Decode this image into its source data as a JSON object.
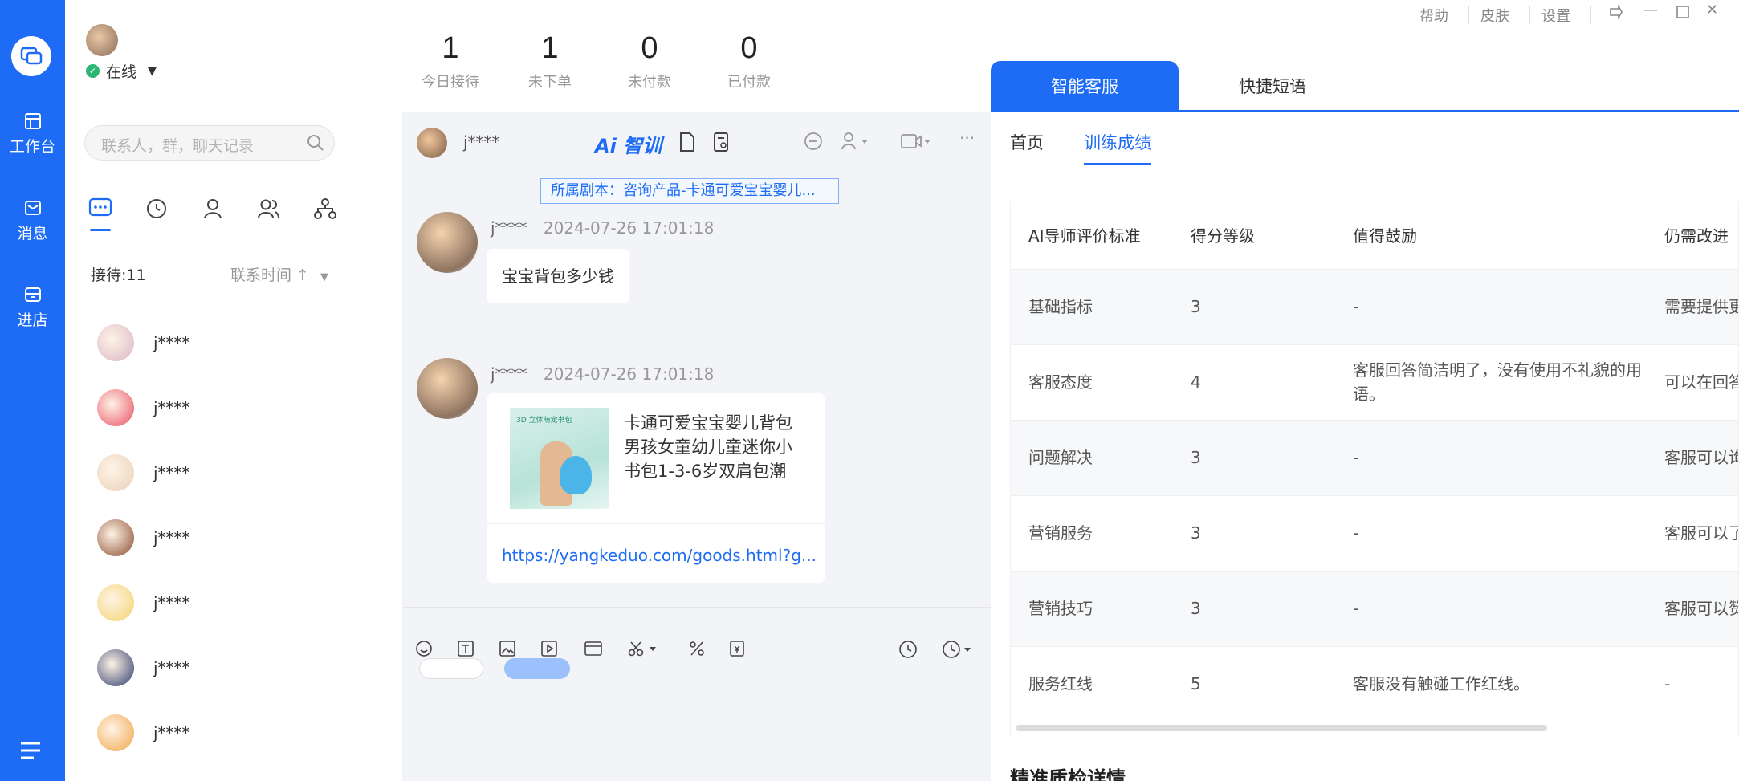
{
  "rail": {
    "items": [
      {
        "label": "工作台",
        "icon": "workbench-icon"
      },
      {
        "label": "消息",
        "icon": "message-icon"
      },
      {
        "label": "进店",
        "icon": "store-icon"
      }
    ]
  },
  "header": {
    "status": "在线",
    "stats": [
      {
        "value": "1",
        "label": "今日接待"
      },
      {
        "value": "1",
        "label": "未下单"
      },
      {
        "value": "0",
        "label": "未付款"
      },
      {
        "value": "0",
        "label": "已付款"
      }
    ],
    "window_menu": [
      "帮助",
      "皮肤",
      "设置"
    ]
  },
  "contacts": {
    "search_placeholder": "联系人，群，聊天记录",
    "reception": "接待:11",
    "sort": "联系时间 ↑",
    "list": [
      {
        "name": "j****"
      },
      {
        "name": "j****"
      },
      {
        "name": "j****"
      },
      {
        "name": "j****"
      },
      {
        "name": "j****"
      },
      {
        "name": "j****"
      },
      {
        "name": "j****"
      }
    ],
    "avatar_colors": [
      "#d8b6c4",
      "#e84f63",
      "#e9d1b8",
      "#8a4b2f",
      "#f3d36b",
      "#2d3a6b",
      "#f0a64a"
    ]
  },
  "chat": {
    "contact_name": "j****",
    "ai_label": "Ai 智训",
    "script_tag": "所属剧本：咨询产品-卡通可爱宝宝婴儿...",
    "messages": [
      {
        "sender": "j****",
        "time": "2024-07-26 17:01:18",
        "text": "宝宝背包多少钱"
      },
      {
        "sender": "j****",
        "time": "2024-07-26 17:01:18"
      }
    ],
    "goods": {
      "badge": "3D 立体萌宠书包",
      "title": "卡通可爱宝宝婴儿背包男孩女童幼儿童迷你小书包1-3-6岁双肩包潮",
      "link": "https://yangkeduo.com/goods.html?g..."
    }
  },
  "panel": {
    "tabs": [
      "智能客服",
      "快捷短语"
    ],
    "subtabs": [
      "首页",
      "训练成绩"
    ],
    "table": {
      "headers": [
        "AI导师评价标准",
        "得分等级",
        "值得鼓励",
        "仍需改进"
      ],
      "rows": [
        [
          "基础指标",
          "3",
          "-",
          "需要提供更多信息，以便"
        ],
        [
          "客服态度",
          "4",
          "客服回答简洁明了，没有使用不礼貌的用语。",
          "可以在回答中加入如'您好'"
        ],
        [
          "问题解决",
          "3",
          "-",
          "客服可以询问如颜色、"
        ],
        [
          "营销服务",
          "3",
          "-",
          "客服可以了解需求，并"
        ],
        [
          "营销技巧",
          "3",
          "-",
          "客服可以赞美客户、"
        ],
        [
          "服务红线",
          "5",
          "客服没有触碰工作红线。",
          "-"
        ]
      ]
    },
    "section_title": "精准质检详情"
  },
  "colors": {
    "brand": "#1e6cf5",
    "online": "#2bb673"
  }
}
